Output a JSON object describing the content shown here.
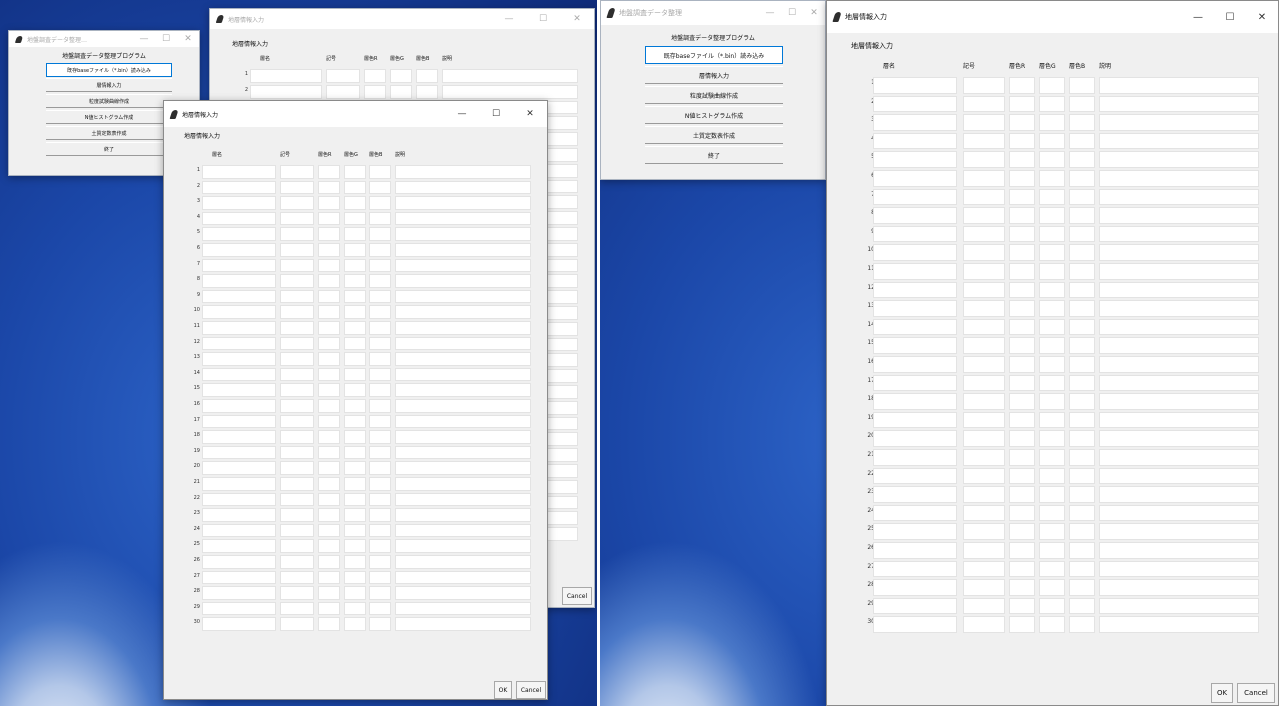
{
  "main_menu": {
    "window_title": "地盤調査データ整理",
    "program_title": "地盤調査データ整理プログラム",
    "buttons": [
      "既存baseファイル（*.bin）読み込み",
      "層情報入力",
      "粒度試験曲線作成",
      "N値ヒストグラム作成",
      "土質定数表作成",
      "終了"
    ]
  },
  "menu_titles_truncated": {
    "left": "地盤調査データ整理…"
  },
  "layer_dialog": {
    "window_title": "地層情報入力",
    "frame_label": "地層情報入力",
    "headers": {
      "name": "層名",
      "symbol": "記号",
      "color_r": "層色R",
      "color_g": "層色G",
      "color_b": "層色B",
      "desc": "説明"
    },
    "row_numbers": [
      "1",
      "2",
      "3",
      "4",
      "5",
      "6",
      "7",
      "8",
      "9",
      "10",
      "11",
      "12",
      "13",
      "14",
      "15",
      "16",
      "17",
      "18",
      "19",
      "20",
      "21",
      "22",
      "23",
      "24",
      "25",
      "26",
      "27",
      "28",
      "29",
      "30"
    ],
    "ok_label": "OK",
    "cancel_label": "Cancel"
  },
  "window_controls": {
    "minimize": "—",
    "maximize": "☐",
    "close": "✕"
  },
  "icons": {
    "app": "tk-feather-icon"
  },
  "colors": {
    "selection_border": "#0078d7",
    "desktop": "#1b47a8"
  }
}
